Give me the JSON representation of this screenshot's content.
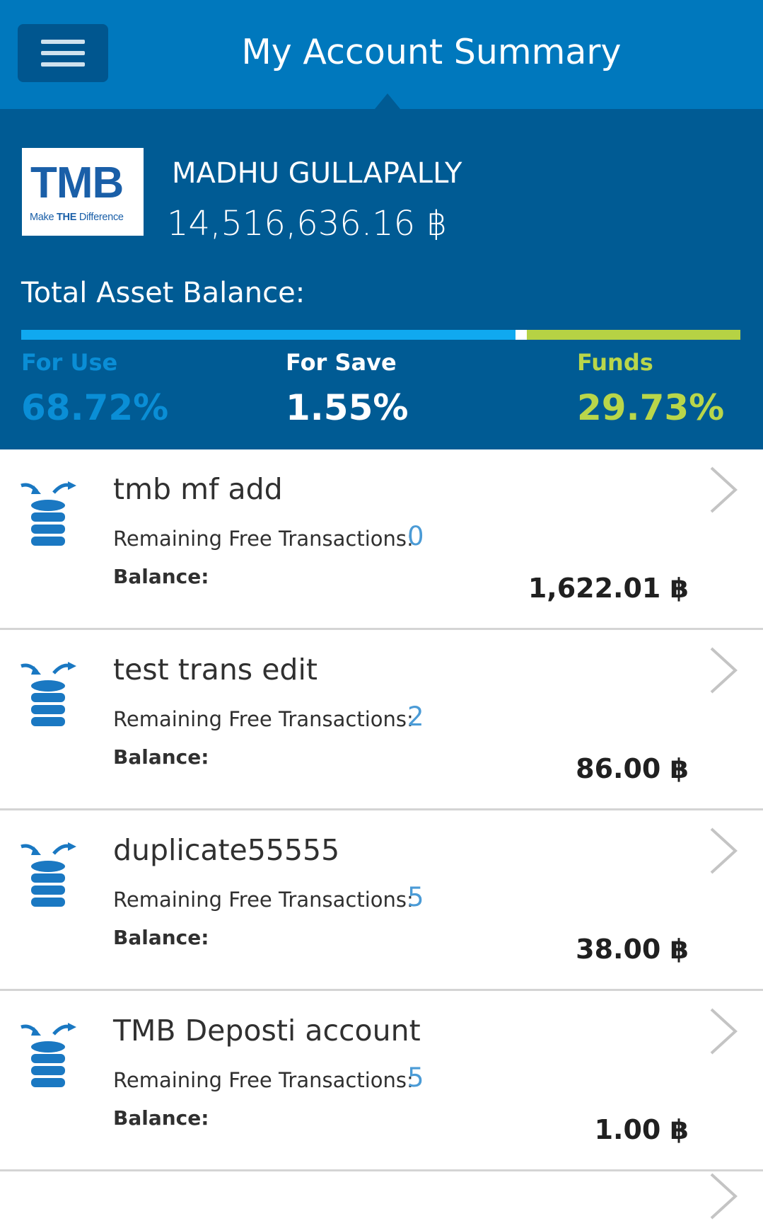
{
  "header": {
    "title": "My Account Summary",
    "menu_icon": "hamburger-menu-icon"
  },
  "profile": {
    "logo_text": "TMB",
    "logo_tagline_pre": "Make ",
    "logo_tagline_bold": "THE",
    "logo_tagline_post": " Difference",
    "name": "MADHU GULLAPALLY",
    "balance": "14,516,636.16 ฿"
  },
  "total_asset": {
    "label": "Total Asset Balance:",
    "for_use_label": "For Use",
    "for_use_value": "68.72%",
    "for_use_fraction": 0.6872,
    "for_save_label": "For Save",
    "for_save_value": "1.55%",
    "for_save_fraction": 0.0155,
    "funds_label": "Funds",
    "funds_value": "29.73%",
    "funds_fraction": 0.2973,
    "colors": {
      "for_use": "#10a9f0",
      "for_save": "#ffffff",
      "funds": "#b6d244"
    }
  },
  "accounts_common": {
    "remaining_label": "Remaining Free Transactions:",
    "balance_label": "Balance:",
    "icon": "coin-stack-transfer-icon",
    "chevron_icon": "chevron-right-icon"
  },
  "accounts": [
    {
      "name": "tmb mf add",
      "remaining": "0",
      "balance": "1,622.01 ฿"
    },
    {
      "name": "test trans edit",
      "remaining": "2",
      "balance": "86.00 ฿"
    },
    {
      "name": "duplicate55555",
      "remaining": "5",
      "balance": "38.00 ฿"
    },
    {
      "name": "TMB Deposti account",
      "remaining": "5",
      "balance": "1.00 ฿"
    }
  ]
}
